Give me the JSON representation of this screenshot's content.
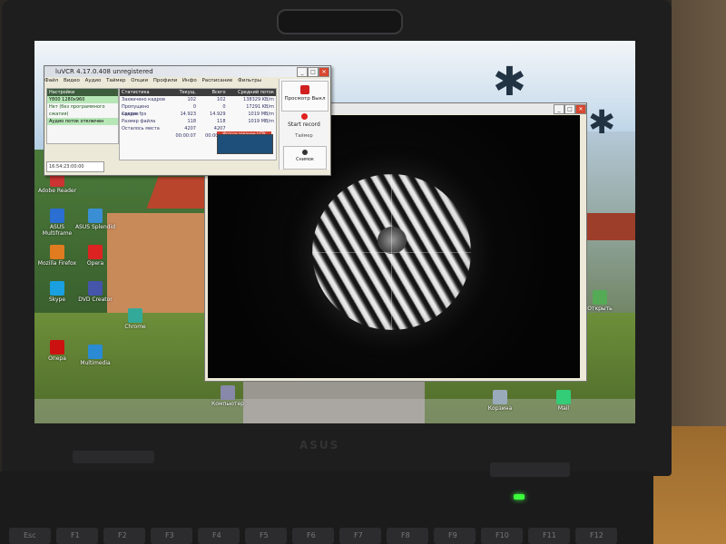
{
  "luvcr": {
    "title": "luVCR 4.17.0.408 unregistered",
    "menu": [
      "Файл",
      "Видео",
      "Аудио",
      "Таймер",
      "Опции",
      "Профили",
      "Инфо",
      "Расписание",
      "Фильтры"
    ],
    "left_panel": {
      "header": "Настройки",
      "rows": [
        "Y800 1280x960",
        "Нет (без программного",
        "сжатия)",
        "Аудио поток отключен"
      ]
    },
    "stats": {
      "headers": [
        "Статистика",
        "Текущ.",
        "Всего",
        "Средний поток"
      ],
      "rows": [
        [
          "Захвачено кадров",
          "102",
          "102",
          "138329 KB/m"
        ],
        [
          "Пропущено кадров",
          "0",
          "0",
          "17291 KB/m"
        ],
        [
          "Средн. fps",
          "14.923",
          "14.929",
          "1019 MB/m"
        ],
        [
          "Размер файла",
          "118",
          "118",
          "1019 MB/m"
        ],
        [
          "Осталось места",
          "4207",
          "4207",
          ""
        ],
        [
          "",
          "00:00:07",
          "00:00:07",
          ""
        ]
      ],
      "warning": "Использование ЦПУ"
    },
    "time_field": "16:54:23:00:00",
    "buttons": {
      "preview": "Просмотр Выкл",
      "start_record": "Start record",
      "timer": "Таймер",
      "snapshot": "Снимок"
    }
  },
  "desktop_icons": [
    {
      "label": "Adobe Reader",
      "color": "#c33"
    },
    {
      "label": "ASUS Multiframe",
      "color": "#2a6fd1"
    },
    {
      "label": "ASUS Splendid",
      "color": "#3a8fd4"
    },
    {
      "label": "Mozilla Firefox",
      "color": "#e07b20"
    },
    {
      "label": "Opera",
      "color": "#d22"
    },
    {
      "label": "Skype",
      "color": "#1aa0e0"
    },
    {
      "label": "DVD Creator",
      "color": "#4455aa"
    },
    {
      "label": "Chrome",
      "color": "#3a9"
    },
    {
      "label": "Опера",
      "color": "#c11"
    },
    {
      "label": "Multimedia",
      "color": "#2a8ad4"
    },
    {
      "label": "Компьютер",
      "color": "#88a"
    },
    {
      "label": "Корзина",
      "color": "#9ab"
    },
    {
      "label": "Открыть",
      "color": "#5a5"
    },
    {
      "label": "Mail",
      "color": "#3c7"
    }
  ],
  "keyboard": [
    "Esc",
    "F1",
    "F2",
    "F3",
    "F4",
    "F5",
    "F6",
    "F7",
    "F8",
    "F9",
    "F10",
    "F11",
    "F12"
  ],
  "brand": "ASUS"
}
